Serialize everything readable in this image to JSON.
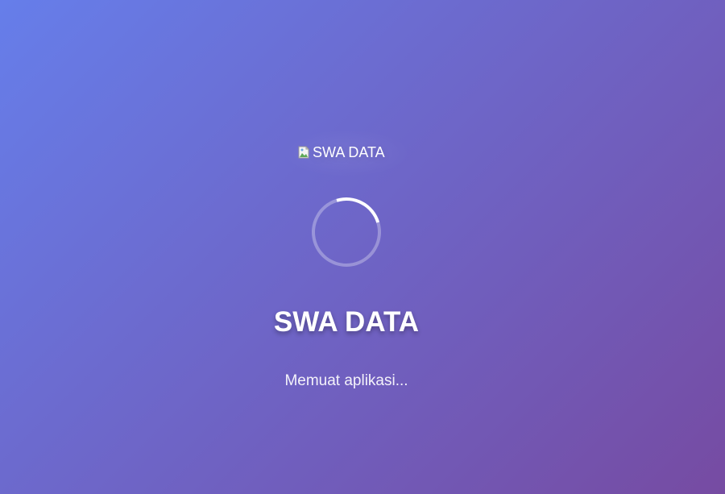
{
  "logo": {
    "alt_text": "SWA DATA",
    "icon": "broken-image-icon"
  },
  "loader": {
    "title": "SWA DATA",
    "status_text": "Memuat aplikasi...",
    "spinner_icon": "loading-spinner-icon"
  },
  "colors": {
    "gradient_start": "#667eea",
    "gradient_end": "#764ba2",
    "text": "#ffffff"
  }
}
